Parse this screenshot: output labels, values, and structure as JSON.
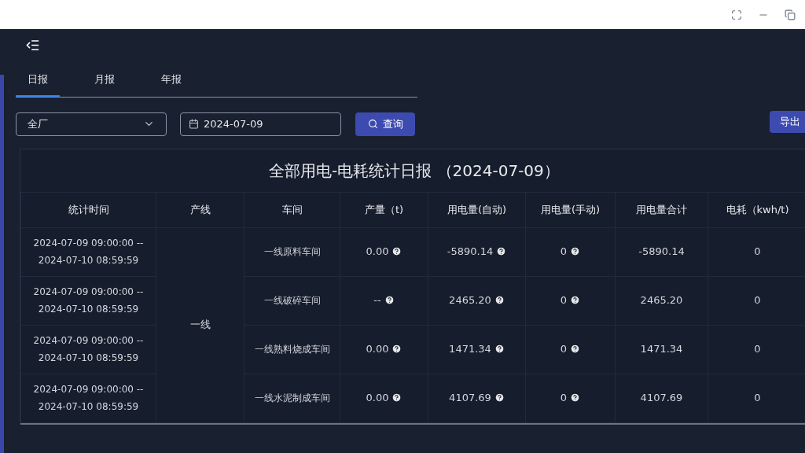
{
  "tabs": [
    {
      "label": "日报",
      "selected": true
    },
    {
      "label": "月报",
      "selected": false
    },
    {
      "label": "年报",
      "selected": false
    }
  ],
  "filters": {
    "scope": "全厂",
    "date": "2024-07-09",
    "query_button": "查询",
    "export_button": "导出"
  },
  "report": {
    "title": "全部用电-电耗统计日报 （2024-07-09）",
    "columns": [
      "统计时间",
      "产线",
      "车间",
      "产量（t)",
      "用电量(自动)",
      "用电量(手动)",
      "用电量合计",
      "电耗（kwh/t)"
    ],
    "line": "一线",
    "rows": [
      {
        "time": [
          "2024-07-09 09:00:00 --",
          "2024-07-10 08:59:59"
        ],
        "workshop": "一线原料车间",
        "output": {
          "text": "0.00",
          "help": true
        },
        "auto": {
          "text": "-5890.14",
          "help": true
        },
        "manual": {
          "text": "0",
          "help": true
        },
        "total": "-5890.14",
        "consumption": "0"
      },
      {
        "time": [
          "2024-07-09 09:00:00 --",
          "2024-07-10 08:59:59"
        ],
        "workshop": "一线破碎车间",
        "output": {
          "text": "--",
          "help": true
        },
        "auto": {
          "text": "2465.20",
          "help": true
        },
        "manual": {
          "text": "0",
          "help": true
        },
        "total": "2465.20",
        "consumption": "0"
      },
      {
        "time": [
          "2024-07-09 09:00:00 --",
          "2024-07-10 08:59:59"
        ],
        "workshop": "一线熟料烧成车间",
        "output": {
          "text": "0.00",
          "help": true
        },
        "auto": {
          "text": "1471.34",
          "help": true
        },
        "manual": {
          "text": "0",
          "help": true
        },
        "total": "1471.34",
        "consumption": "0"
      },
      {
        "time": [
          "2024-07-09 09:00:00 --",
          "2024-07-10 08:59:59"
        ],
        "workshop": "一线水泥制成车间",
        "output": {
          "text": "0.00",
          "help": true
        },
        "auto": {
          "text": "4107.69",
          "help": true
        },
        "manual": {
          "text": "0",
          "help": true
        },
        "total": "4107.69",
        "consumption": "0"
      }
    ]
  }
}
